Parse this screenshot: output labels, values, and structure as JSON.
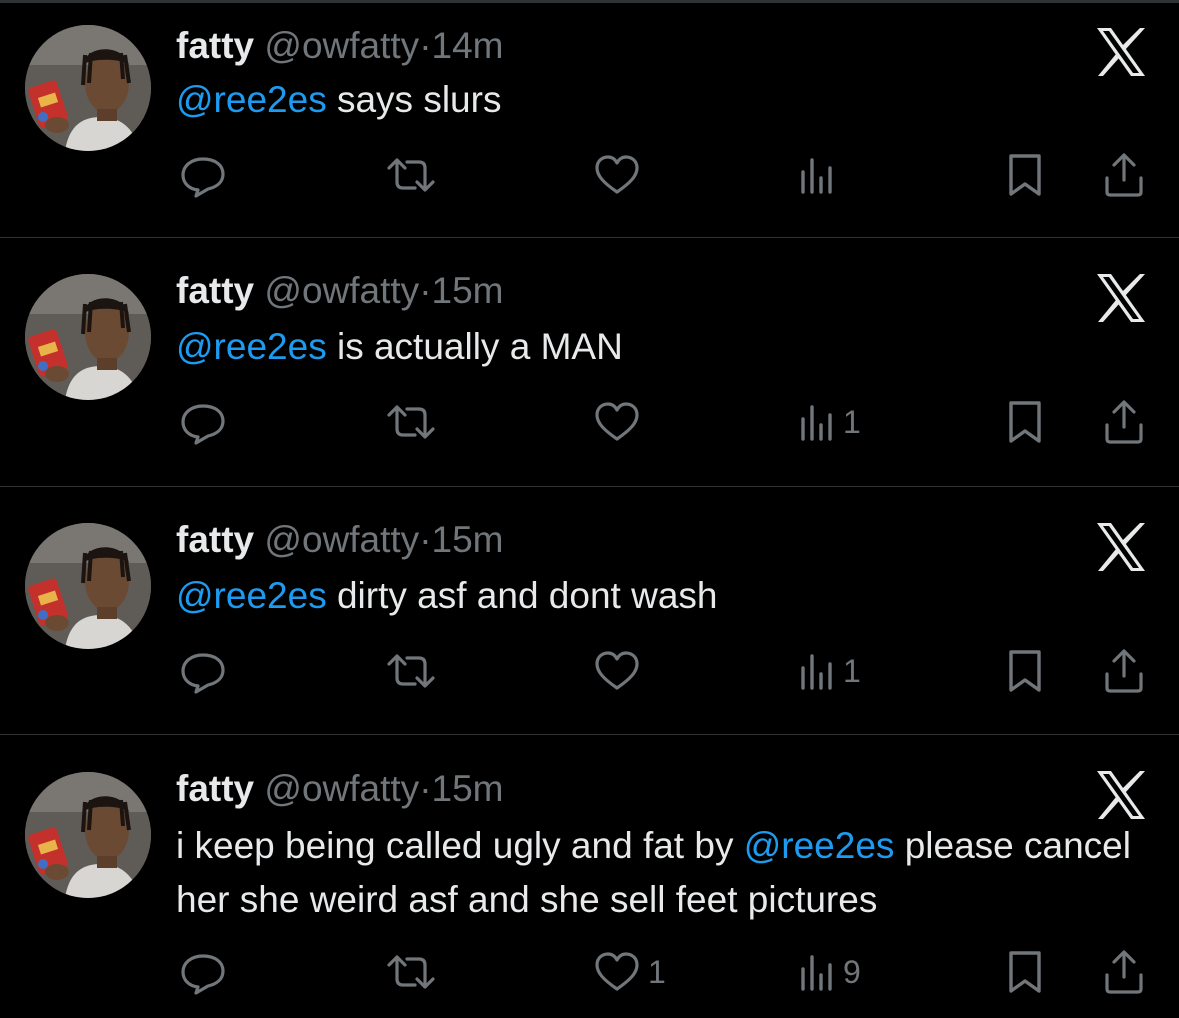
{
  "colors": {
    "background": "#000000",
    "text": "#e7e9ea",
    "muted": "#71767b",
    "mention": "#1d9bf0",
    "divider": "#2f3336"
  },
  "icons": {
    "reply": "reply-icon",
    "repost": "repost-icon",
    "like": "like-icon",
    "views": "views-icon",
    "bookmark": "bookmark-icon",
    "share": "share-icon",
    "platform": "x-logo-icon"
  },
  "tweets": [
    {
      "display_name": "fatty",
      "handle": "@owfatty",
      "separator": "·",
      "time": "14m",
      "body": [
        {
          "type": "mention",
          "text": "@ree2es"
        },
        {
          "type": "text",
          "text": " says slurs"
        }
      ],
      "likes": "",
      "views": ""
    },
    {
      "display_name": "fatty",
      "handle": "@owfatty",
      "separator": "·",
      "time": "15m",
      "body": [
        {
          "type": "mention",
          "text": "@ree2es"
        },
        {
          "type": "text",
          "text": " is actually a MAN"
        }
      ],
      "likes": "",
      "views": "1"
    },
    {
      "display_name": "fatty",
      "handle": "@owfatty",
      "separator": "·",
      "time": "15m",
      "body": [
        {
          "type": "mention",
          "text": "@ree2es"
        },
        {
          "type": "text",
          "text": " dirty asf and dont wash"
        }
      ],
      "likes": "",
      "views": "1"
    },
    {
      "display_name": "fatty",
      "handle": "@owfatty",
      "separator": "·",
      "time": "15m",
      "body": [
        {
          "type": "text",
          "text": "i keep being called ugly and fat by "
        },
        {
          "type": "mention",
          "text": "@ree2es"
        },
        {
          "type": "text",
          "text": " please cancel her she weird asf and she sell feet pictures"
        }
      ],
      "likes": "1",
      "views": "9"
    }
  ]
}
